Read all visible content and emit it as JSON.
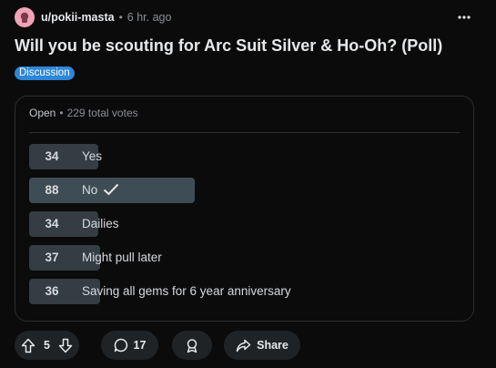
{
  "post": {
    "author": "u/pokii-masta",
    "separator": "•",
    "time": "6 hr. ago",
    "title": "Will you be scouting for Arc Suit Silver & Ho-Oh? (Poll)",
    "flair": "Discussion"
  },
  "poll": {
    "status": "Open",
    "separator": "•",
    "total_votes": "229 total votes",
    "total": 229,
    "options": [
      {
        "count": "34",
        "label": "Yes",
        "votes": 34,
        "selected": false
      },
      {
        "count": "88",
        "label": "No",
        "votes": 88,
        "selected": true
      },
      {
        "count": "34",
        "label": "Dailies",
        "votes": 34,
        "selected": false
      },
      {
        "count": "37",
        "label": "Might pull later",
        "votes": 37,
        "selected": false
      },
      {
        "count": "36",
        "label": "Saving all gems for 6 year anniversary",
        "votes": 36,
        "selected": false
      }
    ]
  },
  "actions": {
    "score": "5",
    "comments": "17",
    "share_label": "Share"
  },
  "colors": {
    "background": "#0b0b0c",
    "flair": "#2e86d8",
    "bar": "#333d42",
    "bar_selected": "#3e4d55",
    "avatar": "#f0a3b7"
  },
  "icons": [
    "avatar-icon",
    "more-options-icon",
    "checkmark-icon",
    "upvote-icon",
    "downvote-icon",
    "comment-icon",
    "award-icon",
    "share-icon"
  ]
}
